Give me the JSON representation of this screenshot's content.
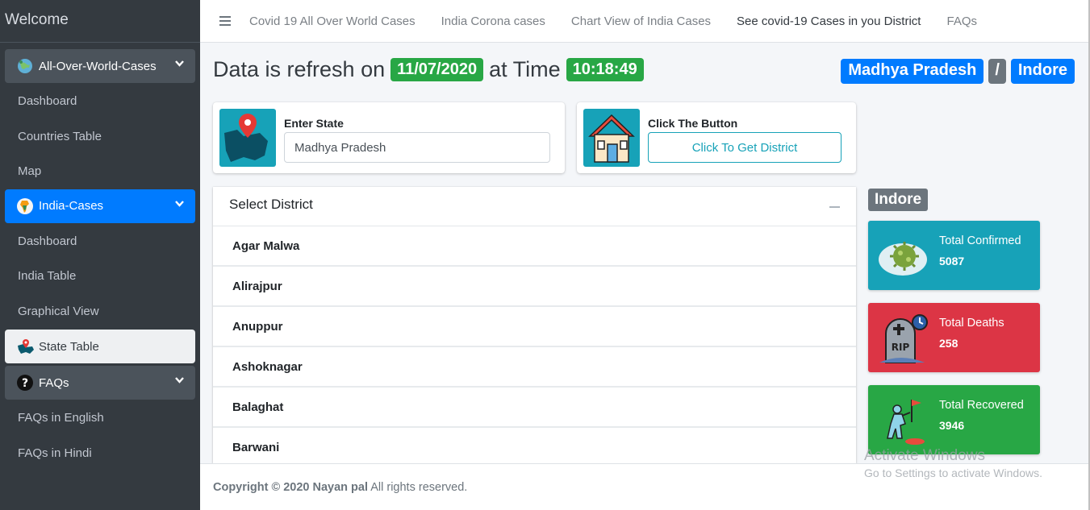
{
  "sidebar": {
    "brand": "Welcome",
    "groups": [
      {
        "label": "All-Over-World-Cases",
        "icon": "globe-virus-icon"
      },
      {
        "label": "India-Cases",
        "icon": "india-map-icon"
      },
      {
        "label": "FAQs",
        "icon": "question-icon"
      }
    ],
    "world_items": [
      "Dashboard",
      "Countries Table",
      "Map"
    ],
    "india_items": [
      "Dashboard",
      "India Table",
      "Graphical View",
      "State Table"
    ],
    "faq_items": [
      "FAQs in English",
      "FAQs in Hindi"
    ]
  },
  "topnav": {
    "links": [
      "Covid 19 All Over World Cases",
      "India Corona cases",
      "Chart View of India Cases",
      "See covid-19 Cases in you District",
      "FAQs"
    ]
  },
  "header": {
    "prefix": "Data is refresh on",
    "date": "11/07/2020",
    "mid": "at Time",
    "time": "10:18:49",
    "state": "Madhya Pradesh",
    "separator": "/",
    "district": "Indore"
  },
  "state_card": {
    "label": "Enter State",
    "value": "Madhya Pradesh",
    "icon": "map-pin-icon"
  },
  "button_card": {
    "label": "Click The Button",
    "button": "Click To Get District",
    "icon": "house-icon"
  },
  "district_list": {
    "title": "Select District",
    "items": [
      "Agar Malwa",
      "Alirajpur",
      "Anuppur",
      "Ashoknagar",
      "Balaghat",
      "Barwani"
    ]
  },
  "stats": {
    "district": "Indore",
    "confirmed": {
      "title": "Total Confirmed",
      "value": "5087",
      "color": "#17a2b8"
    },
    "deaths": {
      "title": "Total Deaths",
      "value": "258",
      "color": "#dc3545"
    },
    "recovered": {
      "title": "Total Recovered",
      "value": "3946",
      "color": "#28a745"
    }
  },
  "footer": {
    "copyright": "Copyright © 2020 Nayan pal",
    "rest": "All rights reserved."
  },
  "watermark": {
    "line1": "Activate Windows",
    "line2": "Go to Settings to activate Windows."
  }
}
